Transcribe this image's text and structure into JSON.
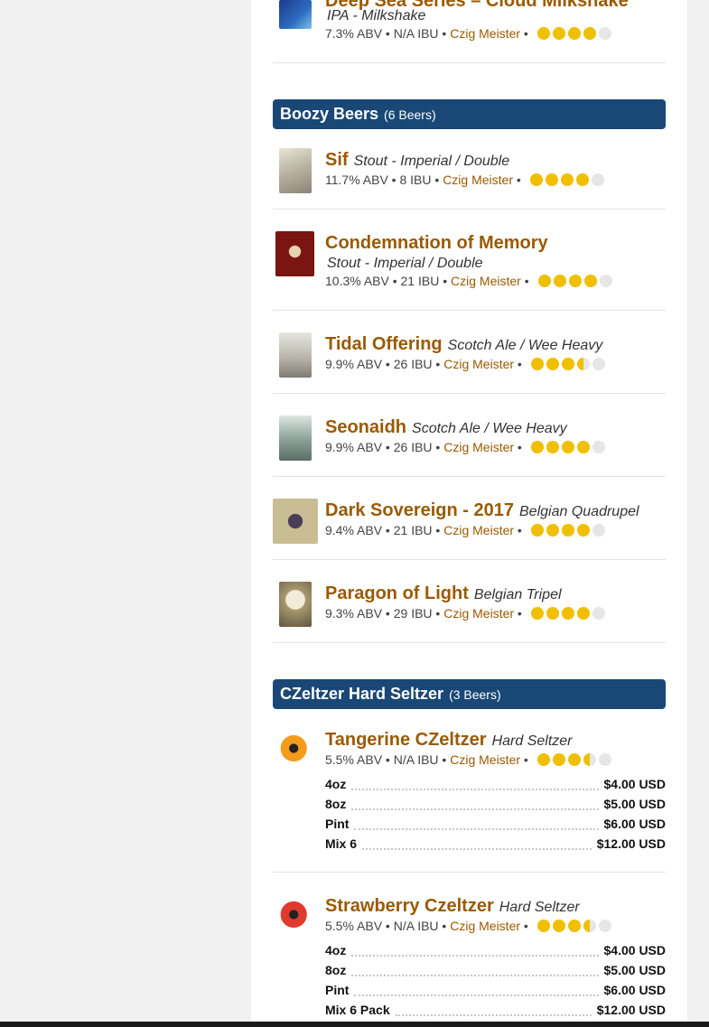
{
  "colors": {
    "accent": "#9a5a00",
    "section_bg": "#1a4876",
    "star_on": "#f0c000",
    "star_off": "#e6e6e6"
  },
  "top_beer": {
    "name": "Deep Sea Series – Cloud Milkshake",
    "style": "IPA - Milkshake",
    "abv": "7.3% ABV",
    "ibu": "N/A IBU",
    "brewery": "Czig Meister",
    "rating": 4
  },
  "sections": [
    {
      "title": "Boozy Beers",
      "count": "(6 Beers)",
      "beers": [
        {
          "name": "Sif",
          "style": "Stout - Imperial / Double",
          "abv": "11.7% ABV",
          "ibu": "8 IBU",
          "brewery": "Czig Meister",
          "rating": 4
        },
        {
          "name": "Condemnation of Memory",
          "style": "Stout - Imperial / Double",
          "abv": "10.3% ABV",
          "ibu": "21 IBU",
          "brewery": "Czig Meister",
          "rating": 4
        },
        {
          "name": "Tidal Offering",
          "style": "Scotch Ale / Wee Heavy",
          "abv": "9.9% ABV",
          "ibu": "26 IBU",
          "brewery": "Czig Meister",
          "rating": 3.5
        },
        {
          "name": "Seonaidh",
          "style": "Scotch Ale / Wee Heavy",
          "abv": "9.9% ABV",
          "ibu": "26 IBU",
          "brewery": "Czig Meister",
          "rating": 4
        },
        {
          "name": "Dark Sovereign - 2017",
          "style": "Belgian Quadrupel",
          "abv": "9.4% ABV",
          "ibu": "21 IBU",
          "brewery": "Czig Meister",
          "rating": 4
        },
        {
          "name": "Paragon of Light",
          "style": "Belgian Tripel",
          "abv": "9.3% ABV",
          "ibu": "29 IBU",
          "brewery": "Czig Meister",
          "rating": 4
        }
      ]
    },
    {
      "title": "CZeltzer Hard Seltzer",
      "count": "(3 Beers)",
      "beers": [
        {
          "name": "Tangerine CZeltzer",
          "style": "Hard Seltzer",
          "abv": "5.5% ABV",
          "ibu": "N/A IBU",
          "brewery": "Czig Meister",
          "rating": 3.5,
          "prices": [
            {
              "size": "4oz",
              "price": "$4.00 USD"
            },
            {
              "size": "8oz",
              "price": "$5.00 USD"
            },
            {
              "size": "Pint",
              "price": "$6.00 USD"
            },
            {
              "size": "Mix 6",
              "price": "$12.00 USD"
            }
          ]
        },
        {
          "name": "Strawberry Czeltzer",
          "style": "Hard Seltzer",
          "abv": "5.5% ABV",
          "ibu": "N/A IBU",
          "brewery": "Czig Meister",
          "rating": 3.5,
          "prices": [
            {
              "size": "4oz",
              "price": "$4.00 USD"
            },
            {
              "size": "8oz",
              "price": "$5.00 USD"
            },
            {
              "size": "Pint",
              "price": "$6.00 USD"
            },
            {
              "size": "Mix 6 Pack",
              "price": "$12.00 USD"
            }
          ]
        }
      ]
    }
  ]
}
